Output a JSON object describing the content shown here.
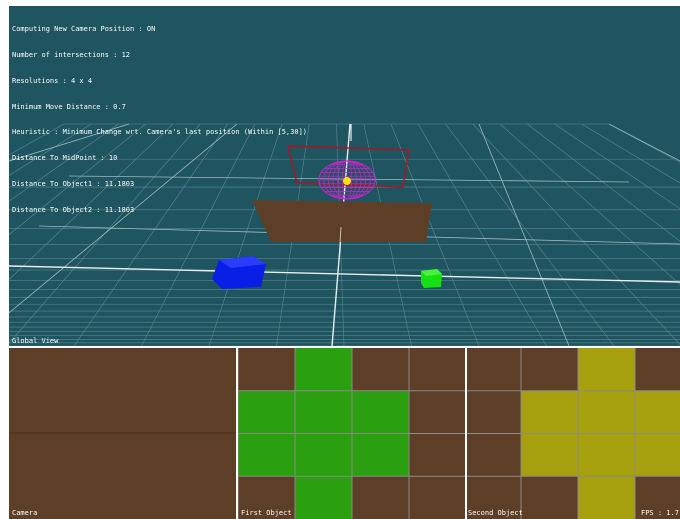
{
  "hud_lines": [
    "Computing New Camera Position : ON",
    "Number of intersections : 12",
    "Resolutions : 4 x 4",
    "Minimum Move Distance : 0.7",
    "Heuristic : Minimum Change wrt. Camera's last position (Within [5,30])",
    "Distance To MidPoint : 10",
    "Distance To Object1 : 11.1803",
    "Distance To Object2 : 11.1803"
  ],
  "labels": {
    "global_view": "Global View",
    "camera": "Camera",
    "first_object": "First Object",
    "second_object": "Second Object",
    "fps": "FPS : 1.7"
  },
  "colors": {
    "background": "#1e5560",
    "floor_brown": "#5c3f26",
    "green_fill": "#2aa011",
    "yellow_fill": "#a7a00e",
    "blue_cube": "#0a1fe6",
    "green_cube": "#17e012",
    "wire_sphere": "#d21fd2",
    "red_frame": "#b3121e"
  },
  "first_object_grid": [
    [
      0,
      1,
      0,
      0
    ],
    [
      1,
      1,
      1,
      0
    ],
    [
      1,
      1,
      1,
      0
    ],
    [
      0,
      1,
      0,
      0
    ]
  ],
  "second_object_grid": [
    [
      0,
      0,
      1,
      0
    ],
    [
      0,
      1,
      1,
      1
    ],
    [
      0,
      1,
      1,
      1
    ],
    [
      0,
      0,
      1,
      0
    ]
  ]
}
